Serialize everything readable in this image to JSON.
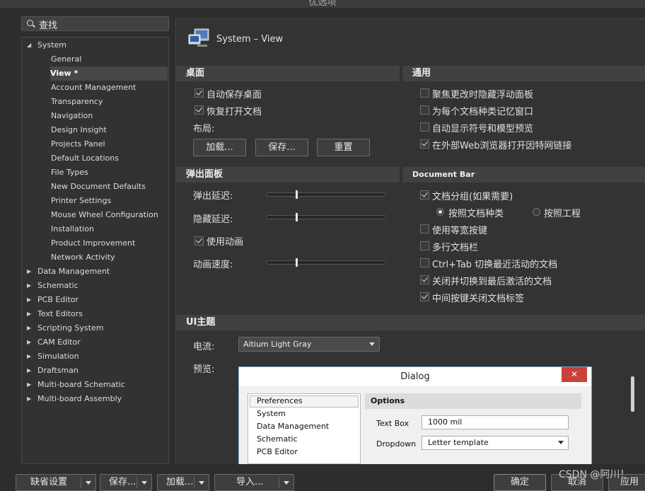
{
  "window": {
    "title": "优选项"
  },
  "search": {
    "placeholder": "查找"
  },
  "tree": {
    "items": [
      {
        "label": "System",
        "expanded": true
      },
      {
        "label": "General"
      },
      {
        "label": "View *",
        "selected": true
      },
      {
        "label": "Account Management"
      },
      {
        "label": "Transparency"
      },
      {
        "label": "Navigation"
      },
      {
        "label": "Design Insight"
      },
      {
        "label": "Projects Panel"
      },
      {
        "label": "Default Locations"
      },
      {
        "label": "File Types"
      },
      {
        "label": "New Document Defaults"
      },
      {
        "label": "Printer Settings"
      },
      {
        "label": "Mouse Wheel Configuration"
      },
      {
        "label": "Installation"
      },
      {
        "label": "Product Improvement"
      },
      {
        "label": "Network Activity"
      },
      {
        "label": "Data Management"
      },
      {
        "label": "Schematic"
      },
      {
        "label": "PCB Editor"
      },
      {
        "label": "Text Editors"
      },
      {
        "label": "Scripting System"
      },
      {
        "label": "CAM Editor"
      },
      {
        "label": "Simulation"
      },
      {
        "label": "Draftsman"
      },
      {
        "label": "Multi-board Schematic"
      },
      {
        "label": "Multi-board Assembly"
      }
    ]
  },
  "page": {
    "title": "System – View"
  },
  "desktop": {
    "header": "桌面",
    "autosave": "自动保存桌面",
    "restore": "恢复打开文档",
    "layout_label": "布局:",
    "load_btn": "加载...",
    "save_btn": "保存...",
    "reset_btn": "重置"
  },
  "general": {
    "header": "通用",
    "opt1": "聚焦更改时隐藏浮动面板",
    "opt2": "为每个文档种类记忆窗口",
    "opt3": "自动显示符号和模型预览",
    "opt4": "在外部Web浏览器打开因特网链接"
  },
  "popup": {
    "header": "弹出面板",
    "delay": "弹出延迟:",
    "hide_delay": "隐藏延迟:",
    "use_anim": "使用动画",
    "anim_speed": "动画速度:"
  },
  "docbar": {
    "header": "Document Bar",
    "group": "文档分组(如果需要)",
    "by_kind": "按照文档种类",
    "by_project": "按照工程",
    "equal_width": "使用等宽按键",
    "multi_row": "多行文档栏",
    "ctrl_tab": "Ctrl+Tab 切换最近活动的文档",
    "close_switch": "关闭并切换到最后激活的文档",
    "middle_close": "中间按键关闭文档标签"
  },
  "theme": {
    "header": "UI主题",
    "current_label": "电流:",
    "current_value": "Altium Light Gray",
    "preview_label": "预览:"
  },
  "preview_dialog": {
    "title": "Dialog",
    "close": "✕",
    "list": [
      "Preferences",
      "System",
      "Data Management",
      "Schematic",
      "PCB Editor"
    ],
    "options_header": "Options",
    "textbox_label": "Text Box",
    "textbox_value": "1000 mil",
    "dropdown_label": "Dropdown",
    "dropdown_value": "Letter template"
  },
  "footer": {
    "defaults": "缺省设置",
    "save": "保存...",
    "load": "加载...",
    "import": "导入...",
    "ok": "确定",
    "cancel": "取消",
    "apply": "应用"
  },
  "watermark": "CSDN @阿川！"
}
